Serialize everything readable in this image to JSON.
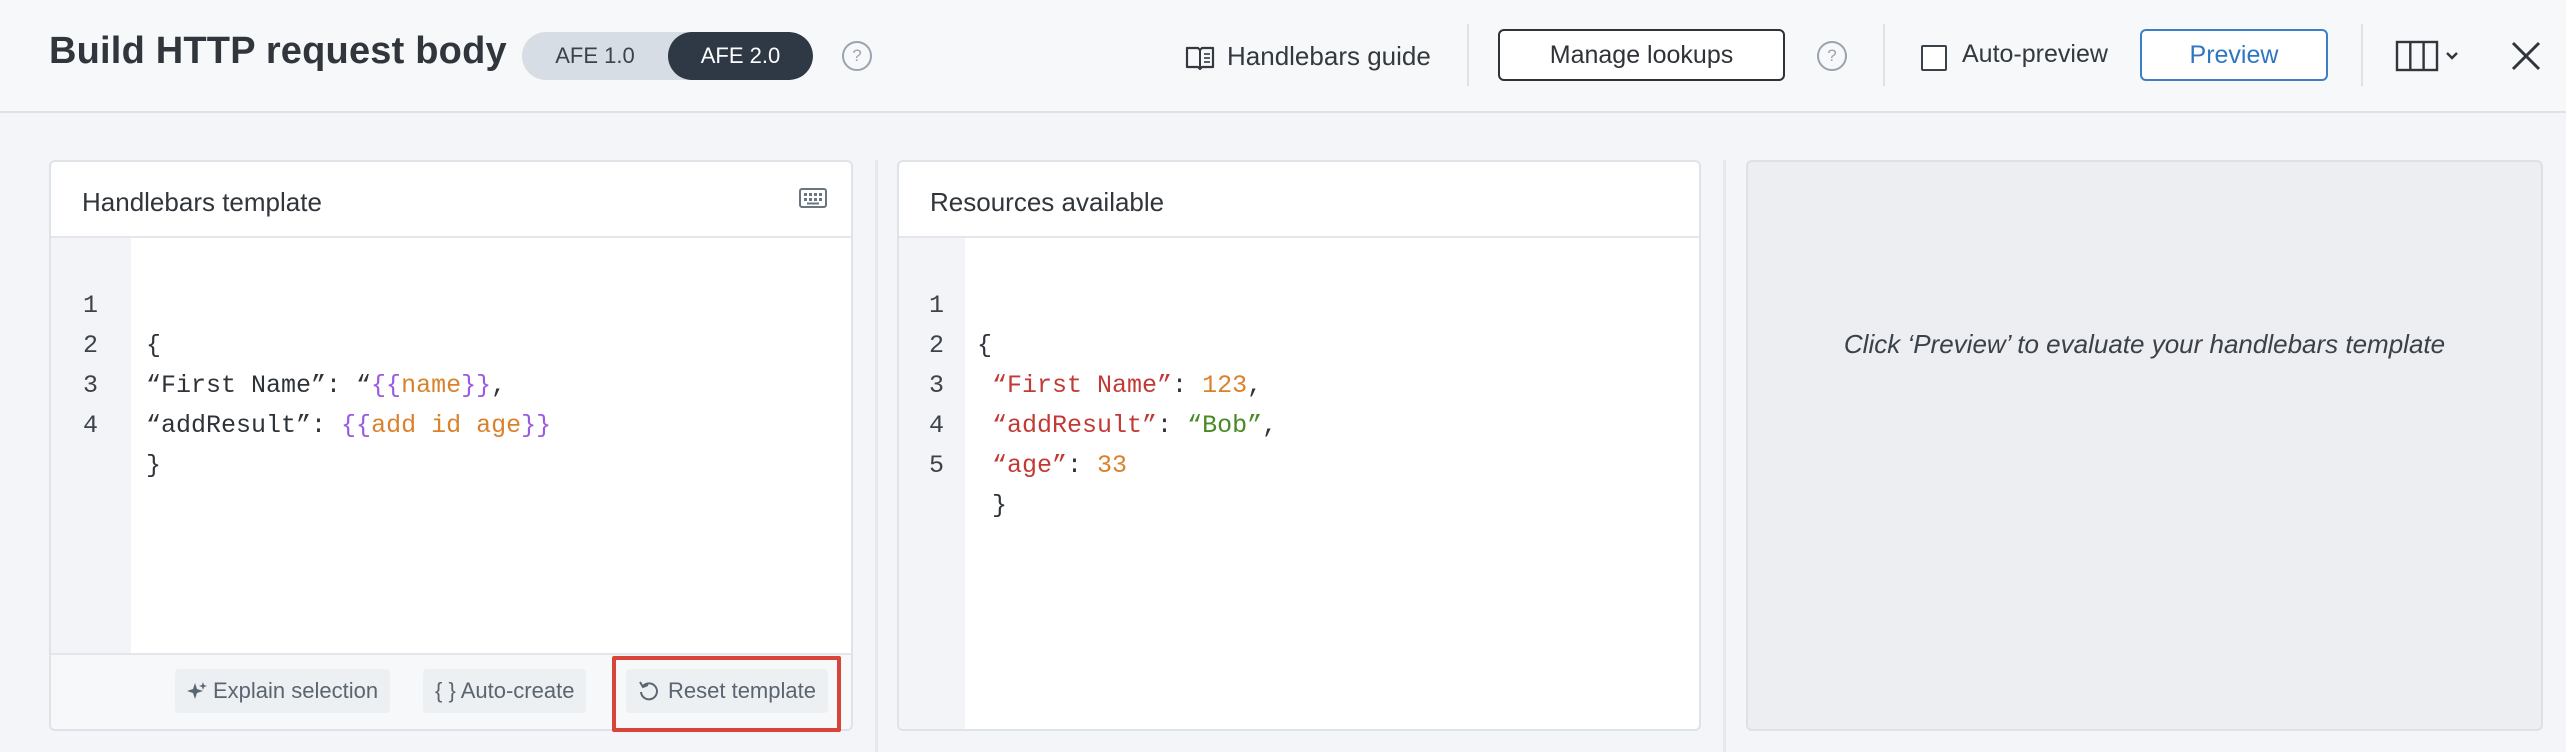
{
  "header": {
    "title": "Build HTTP request body",
    "afe_options": [
      "AFE 1.0",
      "AFE 2.0"
    ],
    "afe_selected": "AFE 2.0",
    "guide_label": "Handlebars guide",
    "manage_lookups_label": "Manage lookups",
    "auto_preview_label": "Auto-preview",
    "auto_preview_checked": false,
    "preview_label": "Preview",
    "help_glyph": "?"
  },
  "template_panel": {
    "title": "Handlebars template",
    "line_numbers": [
      "1",
      "2",
      "3",
      "4"
    ],
    "lines": [
      "{",
      "“First Name”: “{{name}},",
      "“addResult”: {{add id age}}",
      "}"
    ],
    "footer": {
      "explain_label": "Explain selection",
      "autocreate_label": "{ } Auto-create",
      "reset_label": "Reset template"
    }
  },
  "resources_panel": {
    "title": "Resources available",
    "line_numbers": [
      "1",
      "2",
      "3",
      "4",
      "5"
    ],
    "lines": [
      "{",
      " “First Name”: 123,",
      " “addResult”: “Bob”,",
      " “age”: 33",
      " }"
    ]
  },
  "preview_panel": {
    "hint": "Click ‘Preview’ to evaluate your handlebars template"
  },
  "colors": {
    "accent": "#2f76c3",
    "highlight_box": "#d9443a",
    "afe_selected_bg": "#2f3945"
  },
  "icons": {
    "guide": "book-icon",
    "help": "question-circle-icon",
    "keyboard": "keyboard-icon",
    "explain": "sparkle-icon",
    "reset": "reset-icon",
    "layout": "columns-icon",
    "dropdown": "chevron-down-icon",
    "close": "close-icon"
  }
}
